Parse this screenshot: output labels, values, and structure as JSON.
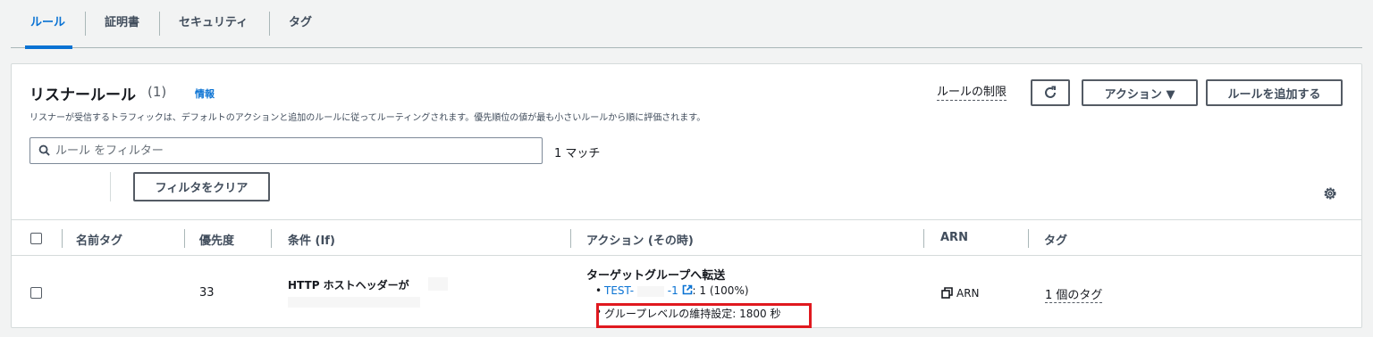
{
  "tabs": [
    {
      "label": "ルール",
      "active": true
    },
    {
      "label": "証明書",
      "active": false
    },
    {
      "label": "セキュリティ",
      "active": false
    },
    {
      "label": "タグ",
      "active": false
    }
  ],
  "panel": {
    "title": "リスナールール",
    "count": "(1)",
    "info": "情報",
    "description": "リスナーが受信するトラフィックは、デフォルトのアクションと追加のルールに従ってルーティングされます。優先順位の値が最も小さいルールから順に評価されます。",
    "limits_link": "ルールの制限",
    "actions_label": "アクション ▼",
    "add_rule_label": "ルールを追加する"
  },
  "filter": {
    "placeholder": "ルール をフィルター",
    "value": "",
    "matches": "1 マッチ",
    "clear_label": "フィルタをクリア"
  },
  "table": {
    "columns": [
      "名前タグ",
      "優先度",
      "条件 (If)",
      "アクション (その時)",
      "ARN",
      "タグ"
    ],
    "rows": [
      {
        "name_tag": "",
        "priority": "33",
        "condition": "HTTP ホストヘッダーが",
        "action_title": "ターゲットグループへ転送",
        "target_group_prefix": "TEST-",
        "target_group_suffix": "-1",
        "target_weight": ": 1 (100%)",
        "stickiness": "グループレベルの維持設定: 1800 秒",
        "arn": "ARN",
        "tags": "1 個のタグ"
      }
    ]
  },
  "colors": {
    "accent": "#0972d3",
    "highlight": "#e0191f",
    "text": "#16191f"
  }
}
